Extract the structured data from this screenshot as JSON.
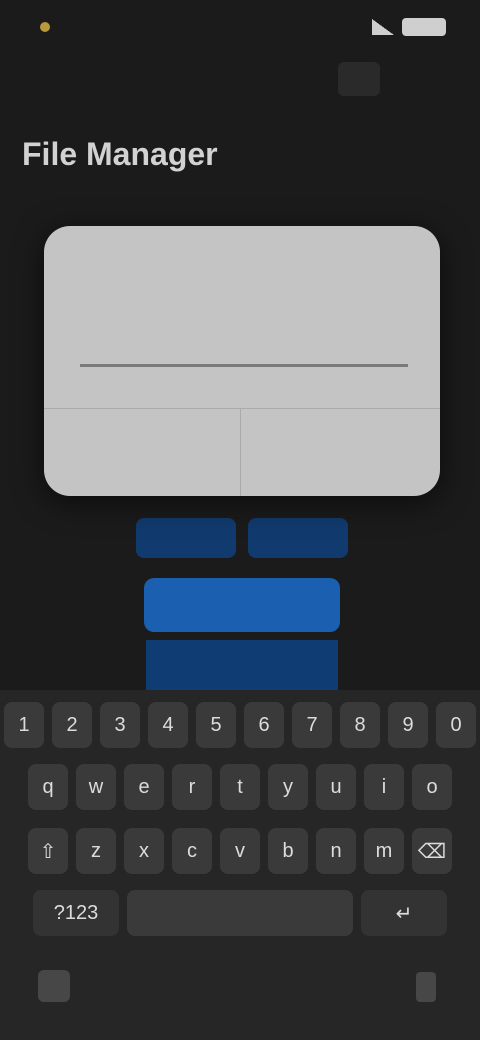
{
  "status_bar": {
    "time": "",
    "battery": ""
  },
  "page": {
    "title": "File Manager"
  },
  "dialog": {
    "title": "",
    "input_value": "",
    "input_placeholder": "",
    "cancel_label": "",
    "ok_label": ""
  },
  "background": {
    "chip_left": "",
    "chip_right": "",
    "primary_label": ""
  },
  "keyboard": {
    "row1": [
      "1",
      "2",
      "3",
      "4",
      "5",
      "6",
      "7",
      "8",
      "9",
      "0"
    ],
    "row2": [
      "q",
      "w",
      "e",
      "r",
      "t",
      "y",
      "u",
      "i",
      "o"
    ],
    "row3": [
      "⇧",
      "z",
      "x",
      "c",
      "v",
      "b",
      "n",
      "m",
      "⌫"
    ],
    "row4": [
      "?123",
      "",
      "↵"
    ]
  }
}
